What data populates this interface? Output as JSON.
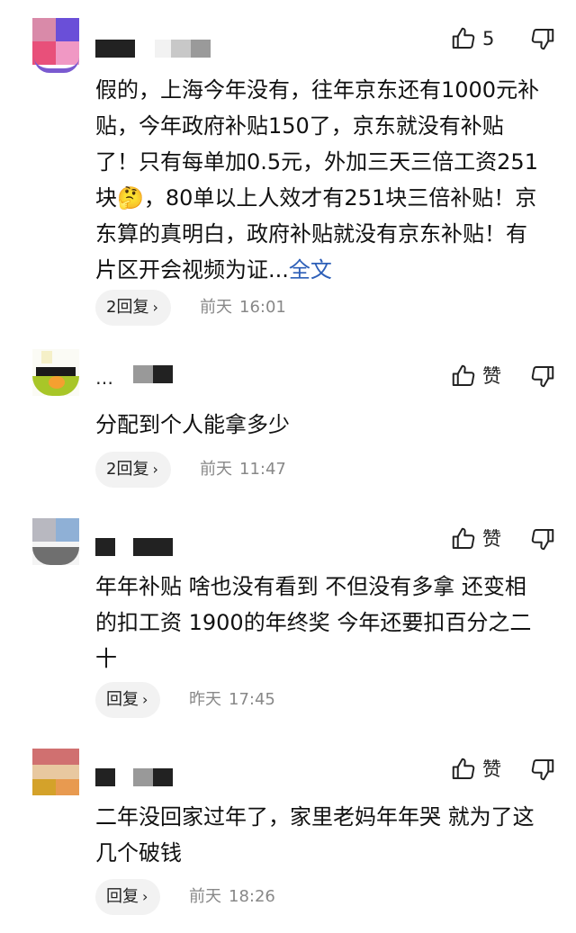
{
  "comments": [
    {
      "like_label": "5",
      "text": "假的，上海今年没有，往年京东还有1000元补贴，今年政府补贴150了，京东就没有补贴了！只有每单加0.5元，外加三天三倍工资251块",
      "emoji": "🤔",
      "text_after_emoji": "，80单以上人效才有251块三倍补贴！京东算的真明白，政府补贴就没有京东补贴！有片区开会视频为证...",
      "more_label": "全文",
      "reply_label": "2回复",
      "time_day": "前天",
      "time_clock": "16:01"
    },
    {
      "name_dots": "…",
      "like_label": "赞",
      "text": "分配到个人能拿多少",
      "reply_label": "2回复",
      "time_day": "前天",
      "time_clock": "11:47"
    },
    {
      "like_label": "赞",
      "text": "年年补贴 啥也没有看到 不但没有多拿 还变相的扣工资 1900的年终奖 今年还要扣百分之二十",
      "reply_label": "回复",
      "time_day": "昨天",
      "time_clock": "17:45"
    },
    {
      "like_label": "赞",
      "text": "二年没回家过年了，家里老妈年年哭 就为了这几个破钱",
      "reply_label": "回复",
      "time_day": "前天",
      "time_clock": "18:26"
    }
  ]
}
